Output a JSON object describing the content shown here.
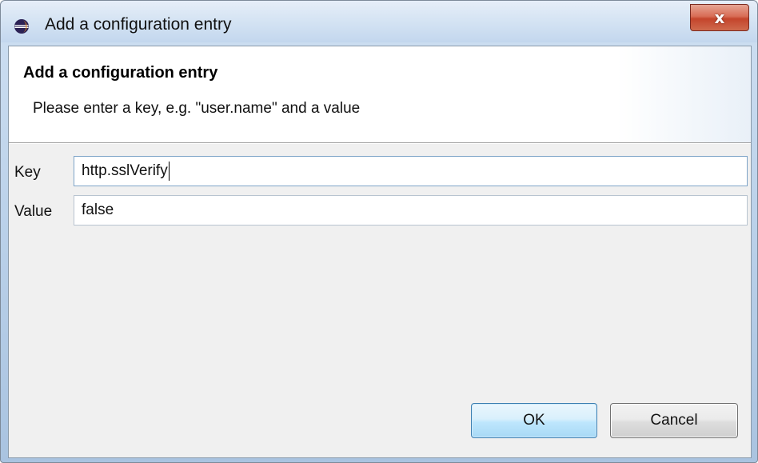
{
  "window": {
    "title": "Add a configuration entry",
    "close_glyph": "x",
    "icon": "eclipse-icon"
  },
  "banner": {
    "title": "Add a configuration entry",
    "message": "Please enter a key, e.g. \"user.name\" and a value"
  },
  "form": {
    "key_label": "Key",
    "key_value": "http.sslVerify",
    "value_label": "Value",
    "value_value": "false"
  },
  "buttons": {
    "ok_label": "OK",
    "cancel_label": "Cancel"
  },
  "colors": {
    "titlebar": "#d4e3f3",
    "close_button": "#c4452c",
    "ok_button_border": "#3c7fb1",
    "dialog_background": "#f0f0f0"
  }
}
